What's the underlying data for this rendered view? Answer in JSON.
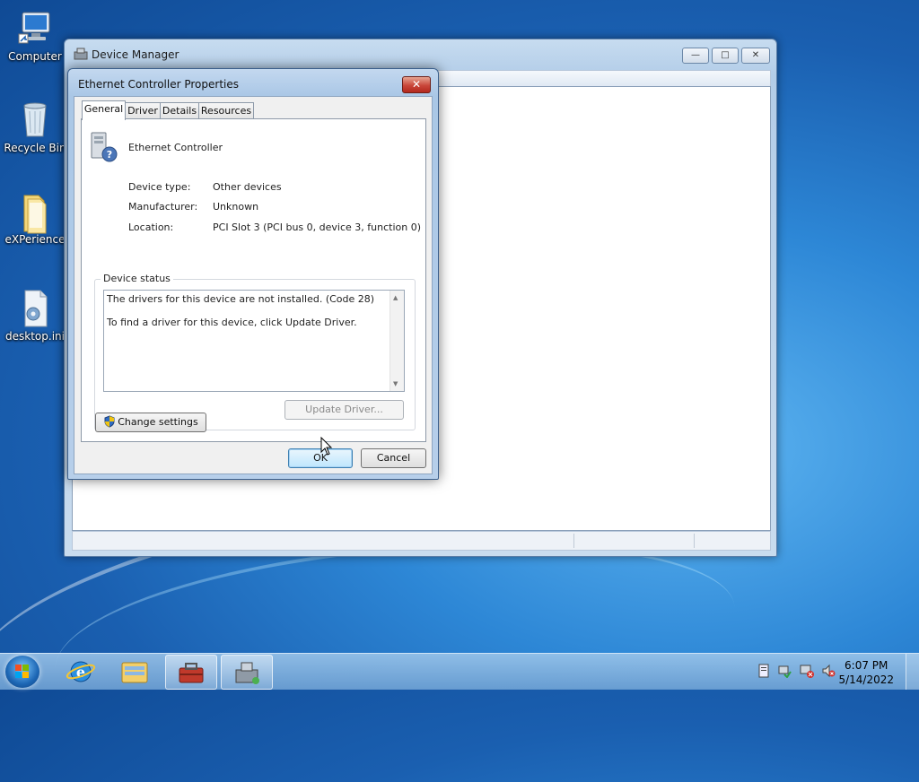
{
  "desktop": {
    "icons": [
      {
        "label": "Computer"
      },
      {
        "label": "Recycle Bin"
      },
      {
        "label": "eXPerience"
      },
      {
        "label": "desktop.ini"
      }
    ]
  },
  "main_window": {
    "title": "Device Manager",
    "controls": {
      "minimize": "—",
      "maximize": "□",
      "close": "✕"
    }
  },
  "dialog": {
    "title": "Ethernet Controller Properties",
    "close_glyph": "✕",
    "tabs": [
      {
        "label": "General",
        "active": true
      },
      {
        "label": "Driver",
        "active": false
      },
      {
        "label": "Details",
        "active": false
      },
      {
        "label": "Resources",
        "active": false
      }
    ],
    "device_name": "Ethernet Controller",
    "properties": [
      {
        "label": "Device type:",
        "value": "Other devices"
      },
      {
        "label": "Manufacturer:",
        "value": "Unknown"
      },
      {
        "label": "Location:",
        "value": "PCI Slot 3 (PCI bus 0, device 3, function 0)"
      }
    ],
    "status_group_label": "Device status",
    "status_lines": [
      "The drivers for this device are not installed. (Code 28)",
      "To find a driver for this device, click Update Driver."
    ],
    "update_driver_label": "Update Driver...",
    "change_settings_label": "Change settings",
    "ok_label": "OK",
    "cancel_label": "Cancel"
  },
  "taskbar": {
    "clock_time": "6:07 PM",
    "clock_date": "5/14/2022"
  },
  "colors": {
    "desktop_bg": "#2d87d6",
    "window_frame": "#b3cde8",
    "close_red": "#c9473a",
    "default_button": "#bee6fd"
  }
}
